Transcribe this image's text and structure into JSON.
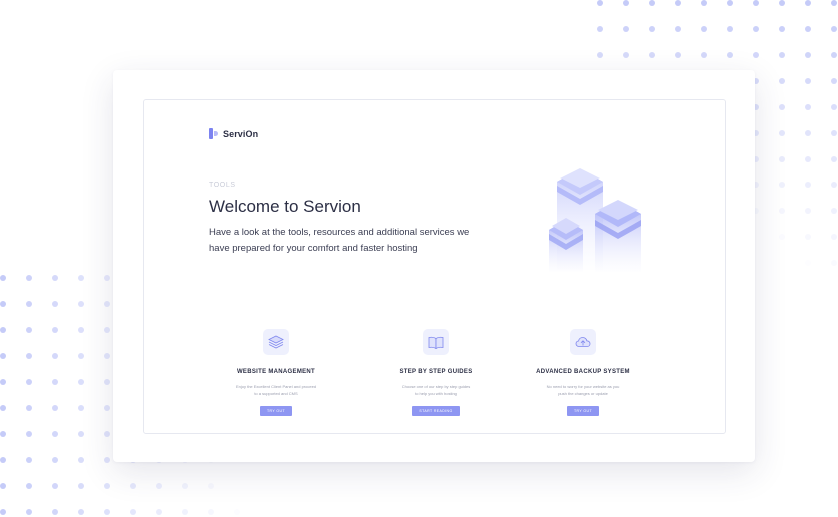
{
  "brand": {
    "name": "ServiOn",
    "accent": "#8e96f2",
    "dot_color": "#c5cbf8"
  },
  "hero": {
    "eyebrow": "TOOLS",
    "title": "Welcome to Servion",
    "subtitle_line1": "Have a look at the tools, resources and additional services we",
    "subtitle_line2": "have prepared for your comfort and faster hosting"
  },
  "features": [
    {
      "icon": "layers-icon",
      "title": "WEBSITE MANAGEMENT",
      "desc_line1": "Enjoy the Excellent Client Panel and proceed",
      "desc_line2": "to a supported and CMS",
      "button": "TRY OUT"
    },
    {
      "icon": "book-icon",
      "title": "STEP BY STEP GUIDES",
      "desc_line1": "Choose one of our step by step guides",
      "desc_line2": "to help you with hosting",
      "button": "START READING"
    },
    {
      "icon": "cloud-upload-icon",
      "title": "ADVANCED BACKUP SYSTEM",
      "desc_line1": "No need to worry for your website as you",
      "desc_line2": "push the changes or update",
      "button": "TRY OUT"
    }
  ]
}
